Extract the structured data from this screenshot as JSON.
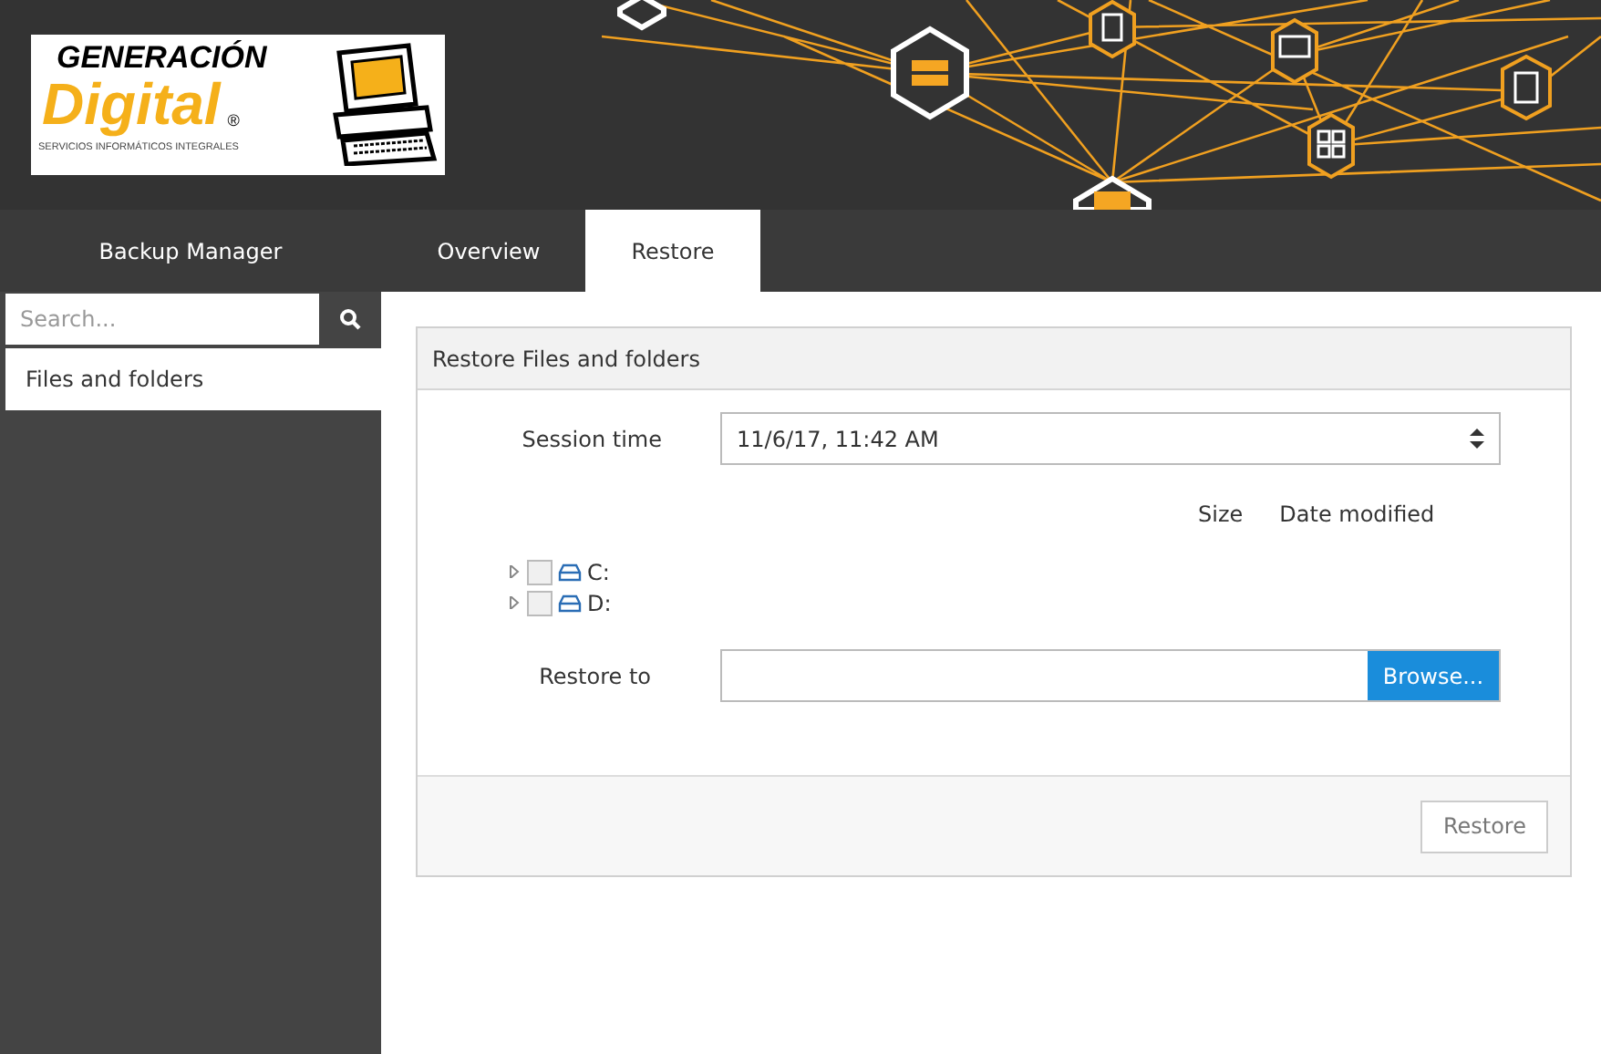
{
  "logo": {
    "title": "GENERACIÓN",
    "name": "Digital",
    "mark": "®",
    "tagline": "SERVICIOS INFORMÁTICOS INTEGRALES"
  },
  "sidebar": {
    "title": "Backup Manager",
    "search": {
      "placeholder": "Search..."
    },
    "items": [
      {
        "label": "Files and folders",
        "selected": true
      }
    ]
  },
  "tabs": [
    {
      "label": "Overview",
      "selected": false
    },
    {
      "label": "Restore",
      "selected": true
    }
  ],
  "panel": {
    "title": "Restore Files and folders",
    "session_time": {
      "label": "Session time",
      "value": "11/6/17, 11:42 AM"
    },
    "columns": [
      "Size",
      "Date modified"
    ],
    "tree": [
      {
        "label": "C:",
        "checked": false,
        "expanded": false
      },
      {
        "label": "D:",
        "checked": false,
        "expanded": false
      }
    ],
    "restore_to": {
      "label": "Restore to",
      "button": "Browse..."
    },
    "footer_button": "Restore"
  }
}
